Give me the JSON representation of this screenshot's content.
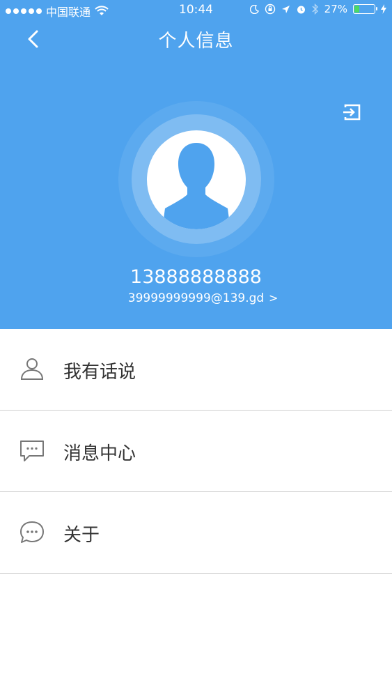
{
  "status_bar": {
    "carrier": "中国联通",
    "time": "10:44",
    "battery": "27%",
    "battery_level": 0.27
  },
  "nav": {
    "title": "个人信息"
  },
  "profile": {
    "phone": "13888888888",
    "email": "39999999999@139.gd",
    "chevron": ">"
  },
  "menu": {
    "items": [
      {
        "label": "我有话说",
        "icon": "person-icon"
      },
      {
        "label": "消息中心",
        "icon": "message-icon"
      },
      {
        "label": "关于",
        "icon": "chat-bubble-icon"
      }
    ]
  },
  "colors": {
    "header_bg": "#4fa3ee",
    "divider": "#cfcfcf",
    "icon_gray": "#777777",
    "text": "#333333"
  }
}
